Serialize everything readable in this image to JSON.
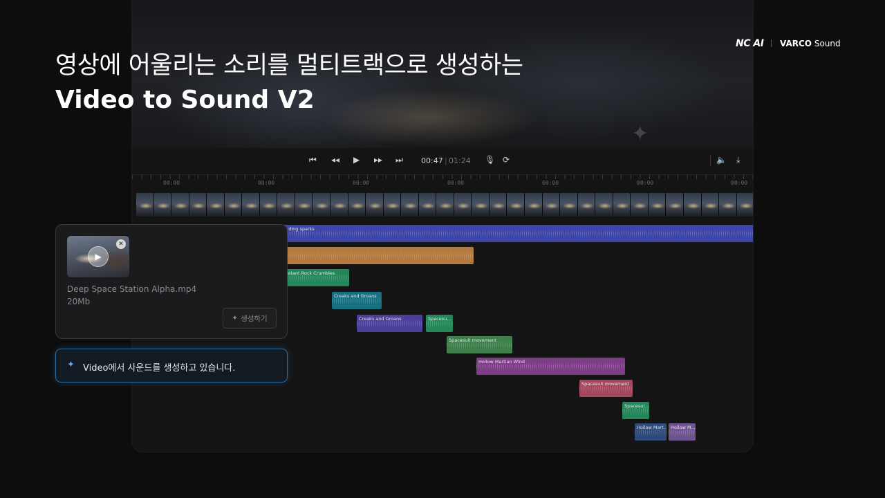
{
  "headline": {
    "korean": "영상에 어울리는 소리를 멀티트랙으로 생성하는",
    "english": "Video to Sound V2"
  },
  "brand": {
    "nc_logo": "NC AI",
    "product_prefix": "VARCO",
    "product_suffix": "Sound"
  },
  "player": {
    "current_time": "00:47",
    "separator": "|",
    "total_time": "01:24",
    "icons": [
      "skip-back-icon",
      "rewind-icon",
      "play-icon",
      "fast-forward-icon",
      "skip-forward-icon",
      "microphone-icon",
      "loop-icon",
      "volume-icon",
      "export-icon"
    ]
  },
  "ruler": {
    "tick_labels": [
      "00:00",
      "00:00",
      "00:00",
      "00:00",
      "00:00",
      "00:00",
      "00:00"
    ]
  },
  "tracks": [
    {
      "label": "...ding sparks",
      "color": "#3e45a8"
    },
    {
      "label": "",
      "color": "#b3793f"
    },
    {
      "label": "...istant Rock Crumbles",
      "color": "#23875a"
    },
    {
      "label": "Creaks and Groans",
      "color": "#17707f"
    },
    {
      "label": "Creaks and Groans",
      "color": "#4a3f9a"
    },
    {
      "label": "Spacesu...",
      "color": "#23875a"
    },
    {
      "label": "Spacesuit movement",
      "color": "#3e7f4c"
    },
    {
      "label": "Hollow Martian Wind",
      "color": "#7c3d86"
    },
    {
      "label": "Spacesuit movement",
      "color": "#a5475c"
    },
    {
      "label": "Spacesui...",
      "color": "#23875a"
    },
    {
      "label": "Hollow Mart...",
      "color": "#2d4a78"
    },
    {
      "label": "Hollow M...",
      "color": "#6e548f"
    }
  ],
  "upload_card": {
    "file_name": "Deep Space Station Alpha.mp4",
    "file_size": "20Mb",
    "generate_label": "생성하기"
  },
  "status": {
    "message": "Video에서 사운드를 생성하고 있습니다."
  }
}
